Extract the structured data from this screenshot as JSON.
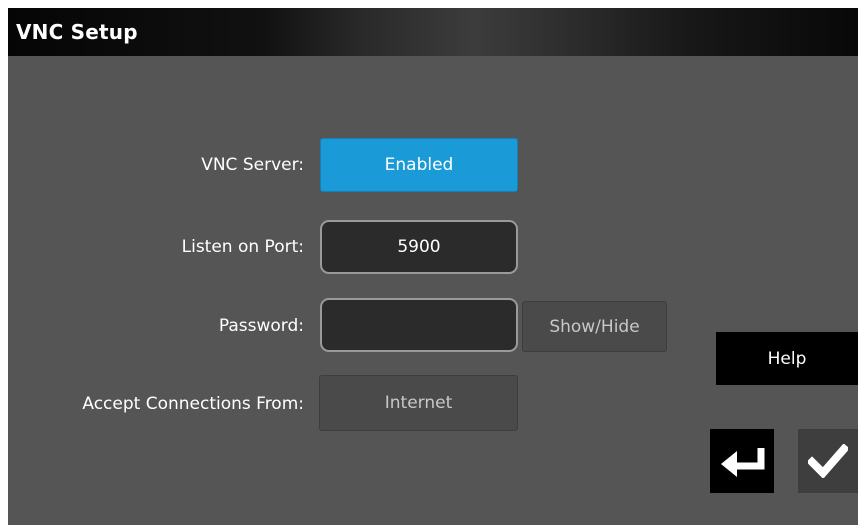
{
  "window": {
    "title": "VNC Setup"
  },
  "form": {
    "vnc_server_label": "VNC Server:",
    "vnc_server_value": "Enabled",
    "listen_port_label": "Listen on Port:",
    "listen_port_value": "5900",
    "password_label": "Password:",
    "password_value": "",
    "show_hide_label": "Show/Hide",
    "accept_from_label": "Accept Connections From:",
    "accept_from_value": "Internet"
  },
  "actions": {
    "help_label": "Help",
    "back_icon": "return-arrow-icon",
    "confirm_icon": "checkmark-icon"
  },
  "colors": {
    "background": "#555555",
    "accent": "#1a9bd7",
    "field": "#2b2b2b"
  }
}
